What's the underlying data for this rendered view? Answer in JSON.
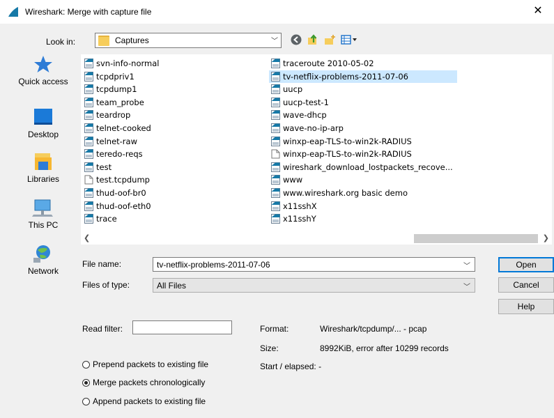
{
  "window": {
    "title": "Wireshark: Merge with capture file",
    "close_glyph": "✕"
  },
  "toolbar": {
    "look_in_label": "Look in:",
    "look_in_value": "Captures",
    "icons": [
      "back-icon",
      "up-folder-icon",
      "new-folder-icon",
      "view-menu-icon"
    ]
  },
  "places": [
    {
      "label": "Quick access",
      "icon": "star-icon"
    },
    {
      "label": "Desktop",
      "icon": "desktop-icon"
    },
    {
      "label": "Libraries",
      "icon": "libraries-icon"
    },
    {
      "label": "This PC",
      "icon": "computer-icon"
    },
    {
      "label": "Network",
      "icon": "network-icon"
    }
  ],
  "files": {
    "left": [
      {
        "name": "svn-info-normal",
        "type": "capture"
      },
      {
        "name": "tcpdpriv1",
        "type": "capture"
      },
      {
        "name": "tcpdump1",
        "type": "capture"
      },
      {
        "name": "team_probe",
        "type": "capture"
      },
      {
        "name": "teardrop",
        "type": "capture"
      },
      {
        "name": "telnet-cooked",
        "type": "capture"
      },
      {
        "name": "telnet-raw",
        "type": "capture"
      },
      {
        "name": "teredo-reqs",
        "type": "capture"
      },
      {
        "name": "test",
        "type": "capture"
      },
      {
        "name": "test.tcpdump",
        "type": "plain"
      },
      {
        "name": "thud-oof-br0",
        "type": "capture"
      },
      {
        "name": "thud-oof-eth0",
        "type": "capture"
      },
      {
        "name": "trace",
        "type": "capture"
      }
    ],
    "right": [
      {
        "name": "traceroute 2010-05-02",
        "type": "capture"
      },
      {
        "name": "tv-netflix-problems-2011-07-06",
        "type": "capture",
        "selected": true
      },
      {
        "name": "uucp",
        "type": "capture"
      },
      {
        "name": "uucp-test-1",
        "type": "capture"
      },
      {
        "name": "wave-dhcp",
        "type": "capture"
      },
      {
        "name": "wave-no-ip-arp",
        "type": "capture"
      },
      {
        "name": "winxp-eap-TLS-to-win2k-RADIUS",
        "type": "capture"
      },
      {
        "name": "winxp-eap-TLS-to-win2k-RADIUS",
        "type": "plain"
      },
      {
        "name": "wireshark_download_lostpackets_recove...",
        "type": "capture"
      },
      {
        "name": "www",
        "type": "capture"
      },
      {
        "name": "www.wireshark.org basic demo",
        "type": "capture"
      },
      {
        "name": "x11sshX",
        "type": "capture"
      },
      {
        "name": "x11sshY",
        "type": "capture"
      }
    ]
  },
  "form": {
    "file_name_label": "File name:",
    "file_name_value": "tv-netflix-problems-2011-07-06",
    "file_type_label": "Files of type:",
    "file_type_value": "All Files",
    "open_label": "Open",
    "cancel_label": "Cancel",
    "help_label": "Help"
  },
  "lower": {
    "read_filter_label": "Read filter:",
    "read_filter_value": "",
    "format_label": "Format:",
    "format_value": "Wireshark/tcpdump/... - pcap",
    "size_label": "Size:",
    "size_value": "8992KiB, error after 10299 records",
    "start_label": "Start / elapsed:",
    "start_value": "-",
    "options": [
      {
        "label": "Prepend packets to existing file",
        "selected": false
      },
      {
        "label": "Merge packets chronologically",
        "selected": true
      },
      {
        "label": "Append packets to existing file",
        "selected": false
      }
    ]
  },
  "colors": {
    "accent": "#0078d7",
    "selection": "#cce8ff",
    "folder": "#f6cd5c"
  }
}
